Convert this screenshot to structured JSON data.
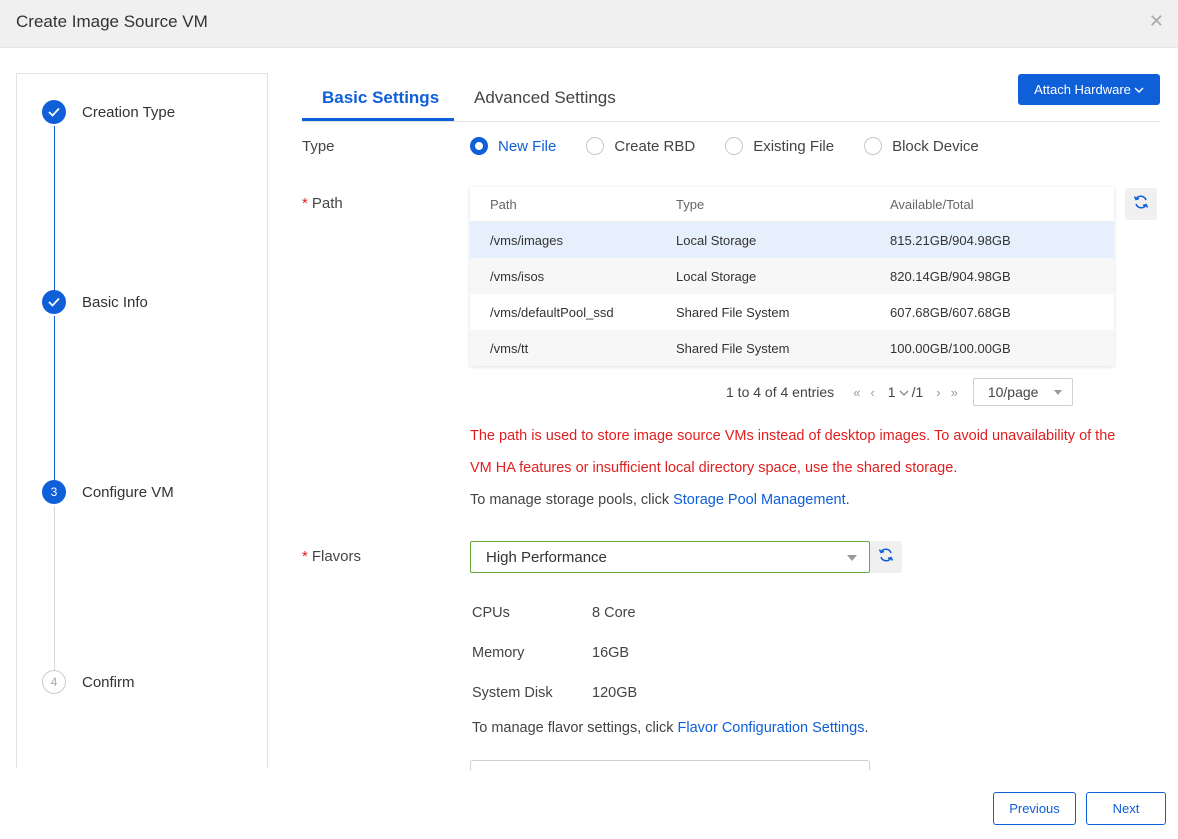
{
  "window": {
    "title": "Create Image Source VM",
    "close_icon": "close-icon"
  },
  "steps": [
    {
      "label": "Creation Type",
      "state": "done",
      "number": "1"
    },
    {
      "label": "Basic Info",
      "state": "done",
      "number": "2"
    },
    {
      "label": "Configure VM",
      "state": "active",
      "number": "3"
    },
    {
      "label": "Confirm",
      "state": "todo",
      "number": "4"
    }
  ],
  "tabs": [
    {
      "label": "Basic Settings",
      "active": true
    },
    {
      "label": "Advanced Settings",
      "active": false
    }
  ],
  "attach_hardware_label": "Attach Hardware",
  "type_field": {
    "label": "Type",
    "options": [
      "New File",
      "Create RBD",
      "Existing File",
      "Block Device"
    ],
    "selected": "New File"
  },
  "path_field": {
    "label": "Path",
    "columns": [
      "Path",
      "Type",
      "Available/Total"
    ],
    "rows": [
      {
        "path": "/vms/images",
        "type": "Local Storage",
        "available": "815.21GB/904.98GB",
        "selected": true
      },
      {
        "path": "/vms/isos",
        "type": "Local Storage",
        "available": "820.14GB/904.98GB",
        "selected": false
      },
      {
        "path": "/vms/defaultPool_ssd",
        "type": "Shared File System",
        "available": "607.68GB/607.68GB",
        "selected": false
      },
      {
        "path": "/vms/tt",
        "type": "Shared File System",
        "available": "100.00GB/100.00GB",
        "selected": false
      }
    ],
    "pager": {
      "summary": "1 to 4 of 4 entries",
      "page": "1",
      "total_pages": "/1",
      "page_size": "10/page"
    },
    "warning_line1": "The path is used to store image source VMs instead of desktop images. To avoid unavailability of the",
    "warning_line2": "VM HA features or insufficient local directory space, use the shared storage.",
    "manage_text": "To manage storage pools, click ",
    "manage_link": "Storage Pool Management",
    "manage_end": "."
  },
  "flavors_field": {
    "label": "Flavors",
    "selected": "High Performance",
    "specs": [
      {
        "name": "CPUs",
        "value": "8 Core"
      },
      {
        "name": "Memory",
        "value": "16GB"
      },
      {
        "name": "System Disk",
        "value": "120GB"
      }
    ],
    "manage_text": "To manage flavor settings, click ",
    "manage_link": "Flavor Configuration Settings",
    "manage_end": "."
  },
  "footer": {
    "previous_label": "Previous",
    "next_label": "Next"
  },
  "colors": {
    "accent": "#0e5fd8",
    "warning": "#e02020",
    "select_border": "#6aaa3c"
  }
}
